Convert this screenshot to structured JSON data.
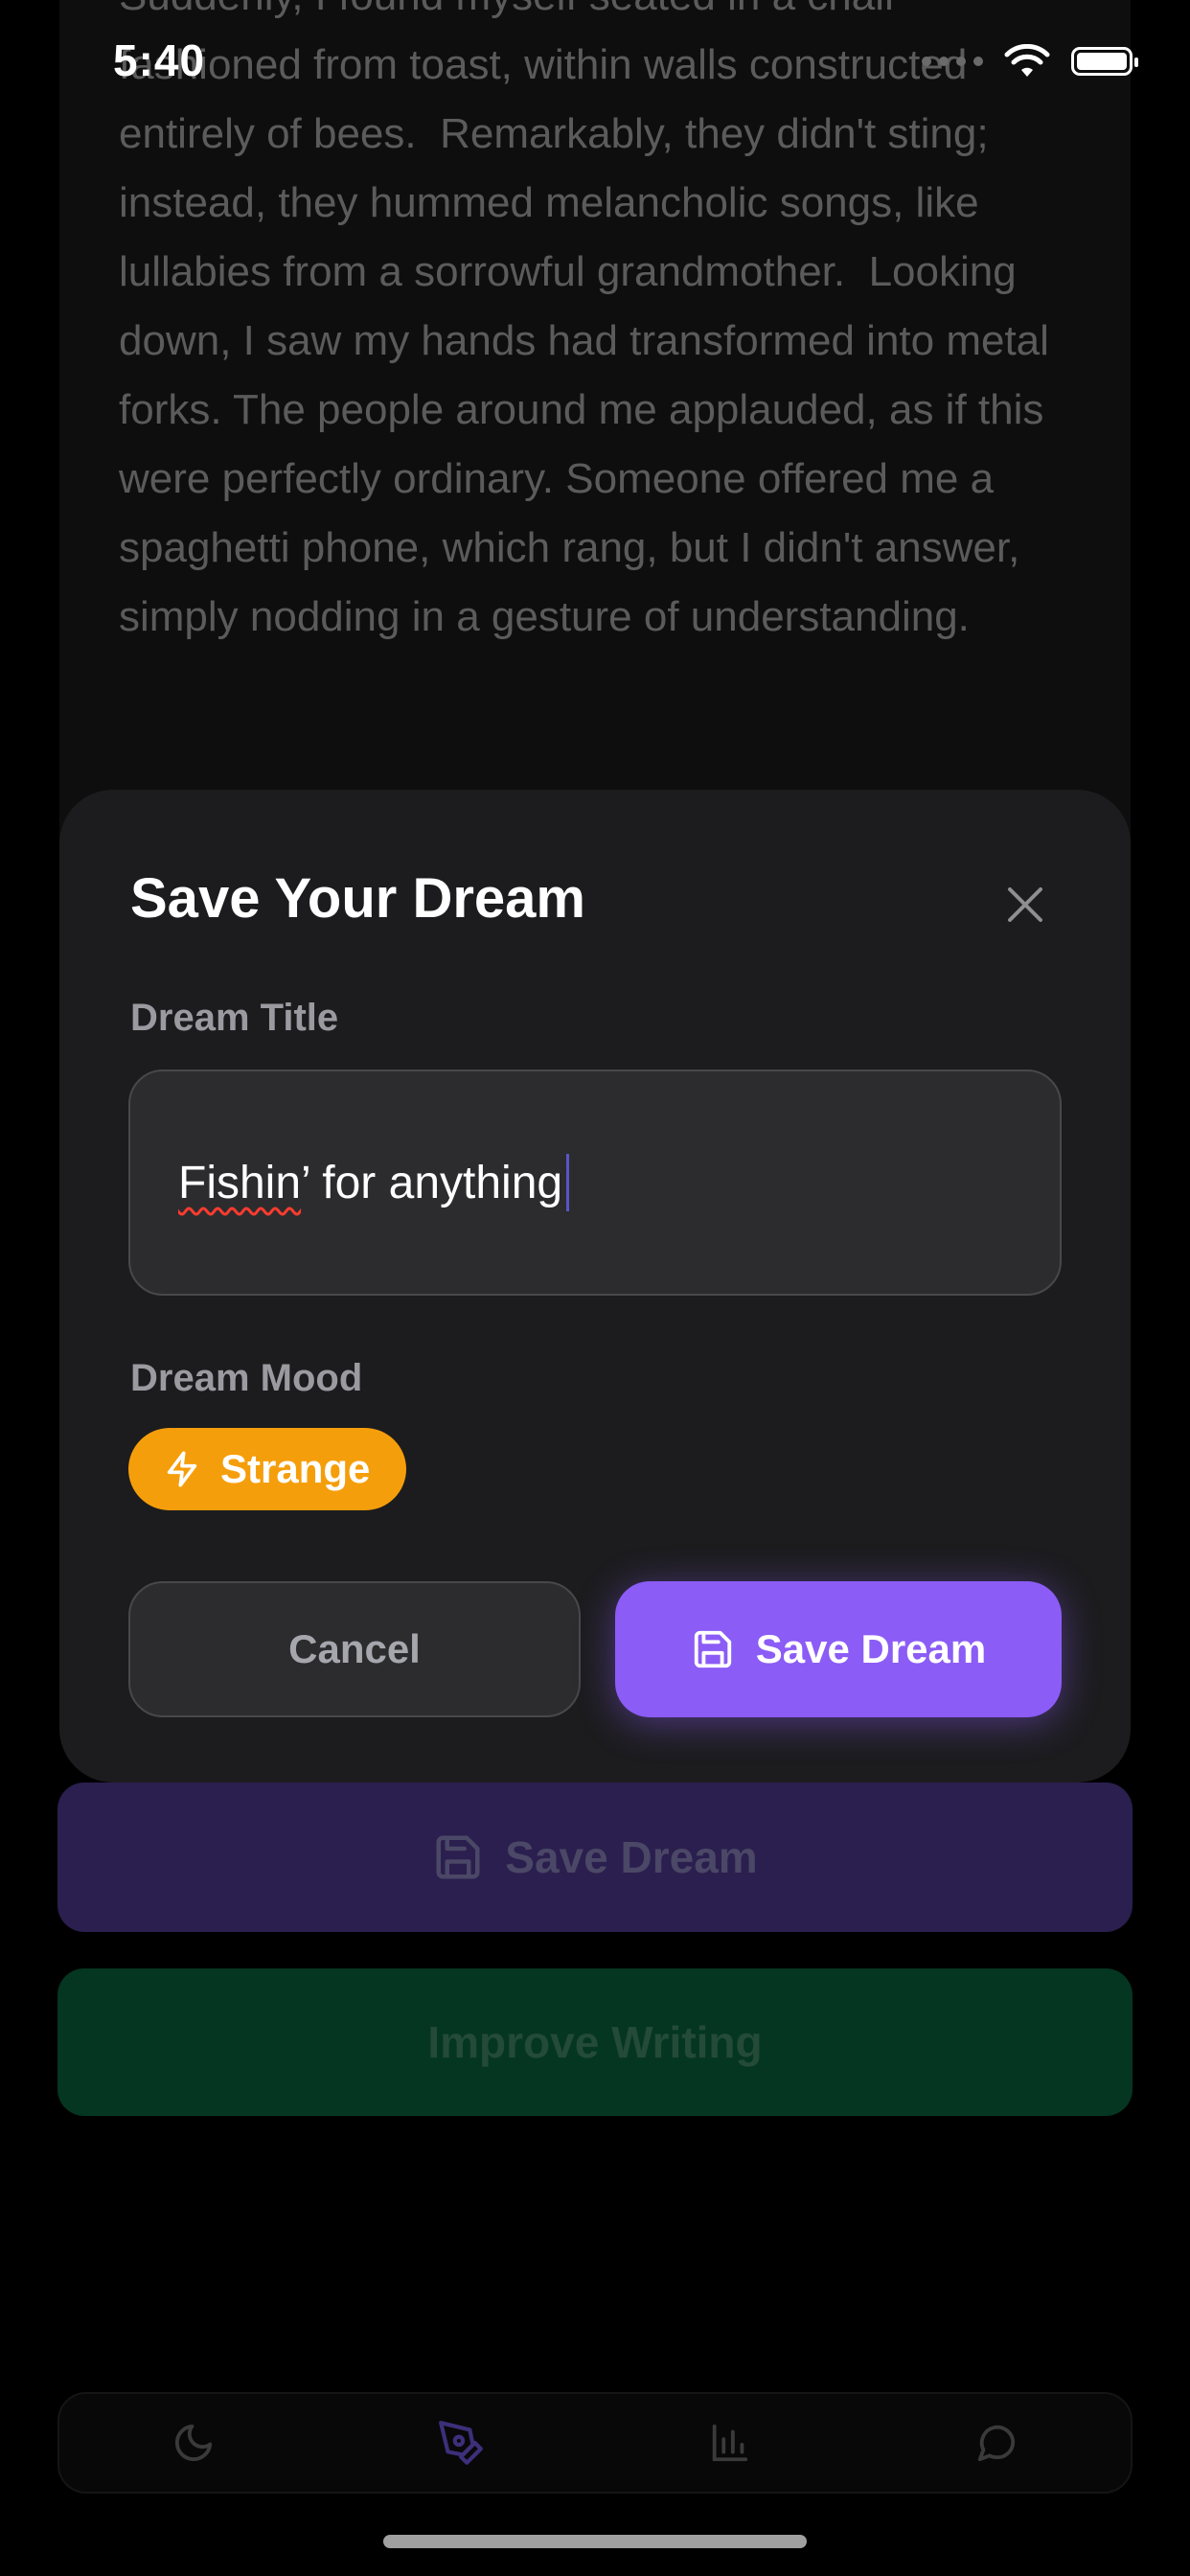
{
  "status_bar": {
    "time": "5:40"
  },
  "dream_entry": {
    "text": "Suddenly, I found myself seated in a chair fashioned from toast, within walls constructed entirely of bees.  Remarkably, they didn't sting; instead, they hummed melancholic songs, like lullabies from a sorrowful grandmother.  Looking down, I saw my hands had transformed into metal forks. The people around me applauded, as if this were perfectly ordinary. Someone offered me a spaghetti phone, which rang, but I didn't answer, simply nodding in a gesture of understanding."
  },
  "modal": {
    "title": "Save Your Dream",
    "title_label": "Dream Title",
    "title_value_misspelled": "Fishin",
    "title_value_rest": "’ for anything",
    "mood_label": "Dream Mood",
    "mood_value": "Strange",
    "cancel_label": "Cancel",
    "save_label": "Save Dream"
  },
  "actions": {
    "save_label": "Save Dream",
    "improve_label": "Improve Writing"
  },
  "tabs": [
    {
      "icon": "moon-icon"
    },
    {
      "icon": "pen-icon",
      "active": true
    },
    {
      "icon": "bar-chart-icon"
    },
    {
      "icon": "chat-bubble-icon"
    }
  ],
  "colors": {
    "accent": "#8b5cf6",
    "mood_strange": "#f59e0b",
    "improve": "#053621"
  }
}
